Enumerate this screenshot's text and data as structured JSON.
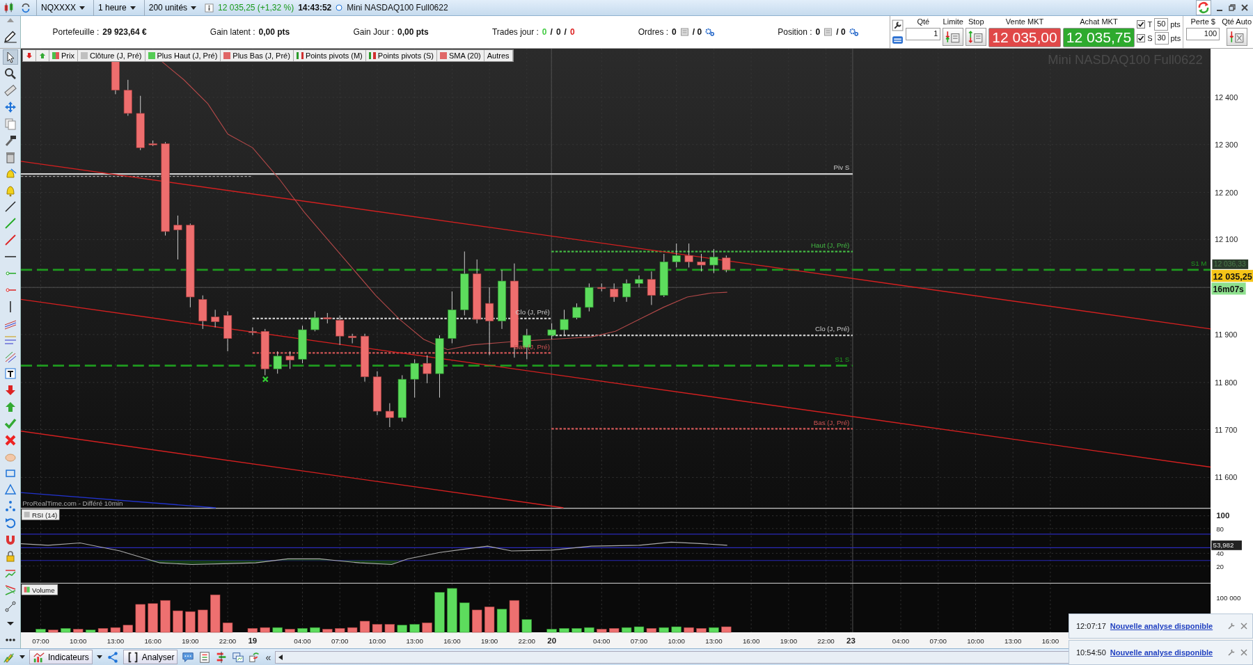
{
  "top_bar": {
    "symbol": "NQXXXX",
    "timeframe": "1 heure",
    "units": "200 unités",
    "quote": "12 035,25 (+1,32 %)",
    "time": "14:43:52",
    "instrument": "Mini NASDAQ100 Full0622"
  },
  "account": [
    {
      "label": "Portefeuille :",
      "value": "29 923,64 €"
    },
    {
      "label": "Gain latent :",
      "value": "0,00 pts"
    },
    {
      "label": "Gain Jour :",
      "value": "0,00 pts"
    }
  ],
  "trades": {
    "label": "Trades jour :",
    "separator": "/",
    "values": [
      {
        "text": "0",
        "color": "#44cc44"
      },
      {
        "text": "0",
        "color": "#222222"
      },
      {
        "text": "0",
        "color": "#dd2222"
      }
    ]
  },
  "orders": {
    "label": "Ordres :",
    "value": "0",
    "count": "/ 0"
  },
  "position": {
    "label": "Position :",
    "value": "0",
    "count": "/ 0"
  },
  "order_panel": {
    "qty_label": "Qté",
    "qty": "1",
    "limit": "Limite",
    "stop": "Stop",
    "sell_label": "Vente MKT",
    "sell": "12 035,00",
    "buy_label": "Achat MKT",
    "buy": "12 035,75",
    "targets": [
      {
        "label": "T",
        "checked": true,
        "value": "50",
        "unit": "pts"
      },
      {
        "label": "S",
        "checked": true,
        "value": "30",
        "unit": "pts"
      }
    ],
    "loss_label": "Perte $",
    "loss": "100",
    "auto_label": "Qté Auto"
  },
  "legend": [
    {
      "label": "Prix",
      "kind": "split"
    },
    {
      "label": "Clôture (J, Pré)",
      "kind": "solid",
      "color": "#c0c0c0"
    },
    {
      "label": "Plus Haut (J, Pré)",
      "kind": "solid",
      "color": "#55cc55"
    },
    {
      "label": "Plus Bas (J, Pré)",
      "kind": "solid",
      "color": "#e06666"
    },
    {
      "label": "Points pivots (M)",
      "kind": "pivot"
    },
    {
      "label": "Points pivots (S)",
      "kind": "pivot"
    },
    {
      "label": "SMA (20)",
      "kind": "solid",
      "color": "#e06666"
    },
    {
      "label": "Autres",
      "kind": "plain"
    }
  ],
  "chart": {
    "watermark": "Mini NASDAQ100 Full0622",
    "source": "ProRealTime.com - Différé 10min",
    "levels": [
      {
        "label": "Piv S",
        "color": "#cccccc"
      },
      {
        "label": "Haut (J, Pré)",
        "color": "#44bb44"
      },
      {
        "label": "S1 M",
        "color": "#1f9a1f"
      },
      {
        "label": "Clo (J, Pré)",
        "color": "#cccccc"
      },
      {
        "label": "Clo (J, Pré)",
        "color": "#cccccc"
      },
      {
        "label": "Bas (J, Pré)",
        "color": "#d05555"
      },
      {
        "label": "S1 S",
        "color": "#1f9a1f"
      },
      {
        "label": "Bas (J, Pré)",
        "color": "#d05555"
      }
    ],
    "price_ticks": [
      "12 400",
      "12 300",
      "12 200",
      "12 100",
      "11 900",
      "11 800",
      "11 700",
      "11 600"
    ],
    "s1m_tag": "12 036,33",
    "price_tag": "12 035,25",
    "timer": "16m07s"
  },
  "rsi": {
    "label": "RSI (14)",
    "ticks": [
      "100",
      "80",
      "40",
      "20"
    ],
    "value": "53,982"
  },
  "volume": {
    "label": "Volume",
    "ticks": [
      "100 000"
    ]
  },
  "time_axis": [
    {
      "text": "07:00",
      "kind": "hour"
    },
    {
      "text": "10:00",
      "kind": "hour"
    },
    {
      "text": "13:00",
      "kind": "hour"
    },
    {
      "text": "16:00",
      "kind": "hour"
    },
    {
      "text": "19:00",
      "kind": "hour"
    },
    {
      "text": "22:00",
      "kind": "hour"
    },
    {
      "text": "19",
      "kind": "day"
    },
    {
      "text": "04:00",
      "kind": "hour"
    },
    {
      "text": "07:00",
      "kind": "hour"
    },
    {
      "text": "10:00",
      "kind": "hour"
    },
    {
      "text": "13:00",
      "kind": "hour"
    },
    {
      "text": "16:00",
      "kind": "hour"
    },
    {
      "text": "19:00",
      "kind": "hour"
    },
    {
      "text": "22:00",
      "kind": "hour"
    },
    {
      "text": "20",
      "kind": "day"
    },
    {
      "text": "04:00",
      "kind": "hour"
    },
    {
      "text": "07:00",
      "kind": "hour"
    },
    {
      "text": "10:00",
      "kind": "hour"
    },
    {
      "text": "13:00",
      "kind": "hour"
    },
    {
      "text": "16:00",
      "kind": "hour"
    },
    {
      "text": "19:00",
      "kind": "hour"
    },
    {
      "text": "22:00",
      "kind": "hour"
    },
    {
      "text": "23",
      "kind": "day"
    },
    {
      "text": "04:00",
      "kind": "hour"
    },
    {
      "text": "07:00",
      "kind": "hour"
    },
    {
      "text": "10:00",
      "kind": "hour"
    },
    {
      "text": "13:00",
      "kind": "hour"
    },
    {
      "text": "16:00",
      "kind": "hour"
    }
  ],
  "bottom_bar": {
    "indicators": "Indicateurs",
    "analyse": "Analyser",
    "collapse": "«"
  },
  "notifications": [
    {
      "time": "12:07:17",
      "text": "Nouvelle analyse disponible"
    },
    {
      "time": "10:54:50",
      "text": "Nouvelle analyse disponible"
    }
  ]
}
